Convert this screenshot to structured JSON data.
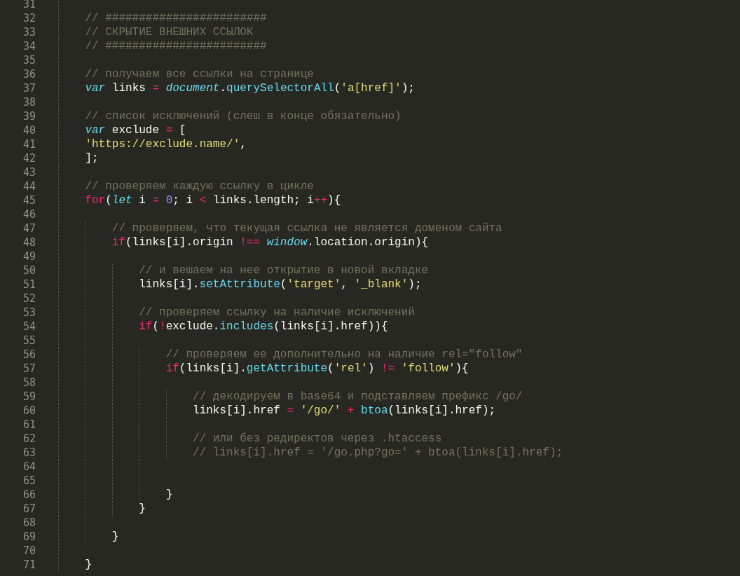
{
  "editor": {
    "lines": [
      {
        "number": "31"
      },
      {
        "number": "32",
        "tokens": [
          {
            "kind": "comment",
            "text": "// ########################"
          }
        ]
      },
      {
        "number": "33",
        "tokens": [
          {
            "kind": "comment",
            "text": "// СКРЫТИЕ ВНЕШНИХ ССЫЛОК"
          }
        ]
      },
      {
        "number": "34",
        "tokens": [
          {
            "kind": "comment",
            "text": "// ########################"
          }
        ]
      },
      {
        "number": "35"
      },
      {
        "number": "36",
        "tokens": [
          {
            "kind": "comment",
            "text": "// получаем все ссылки на странице"
          }
        ]
      },
      {
        "number": "37",
        "tokens": [
          {
            "kind": "storage",
            "text": "var"
          },
          {
            "kind": "plain",
            "text": " links "
          },
          {
            "kind": "operator",
            "text": "= "
          },
          {
            "kind": "storage",
            "text": "document"
          },
          {
            "kind": "plain",
            "text": "."
          },
          {
            "kind": "function",
            "text": "querySelectorAll"
          },
          {
            "kind": "plain",
            "text": "("
          },
          {
            "kind": "string",
            "text": "'a[href]'"
          },
          {
            "kind": "plain",
            "text": ");"
          }
        ]
      },
      {
        "number": "38"
      },
      {
        "number": "39",
        "tokens": [
          {
            "kind": "comment",
            "text": "// список исключений (слеш в конце обязательно)"
          }
        ]
      },
      {
        "number": "40",
        "tokens": [
          {
            "kind": "storage",
            "text": "var"
          },
          {
            "kind": "plain",
            "text": " exclude "
          },
          {
            "kind": "operator",
            "text": "="
          },
          {
            "kind": "plain",
            "text": " ["
          }
        ]
      },
      {
        "number": "41",
        "tokens": [
          {
            "kind": "string",
            "text": "'https://exclude.name/'"
          },
          {
            "kind": "plain",
            "text": ","
          }
        ]
      },
      {
        "number": "42",
        "tokens": [
          {
            "kind": "plain",
            "text": "];"
          }
        ]
      },
      {
        "number": "43"
      },
      {
        "number": "44",
        "tokens": [
          {
            "kind": "comment",
            "text": "// проверяем каждую ссылку в цикле"
          }
        ]
      },
      {
        "number": "45",
        "tokens": [
          {
            "kind": "keyword",
            "text": "for"
          },
          {
            "kind": "plain",
            "text": "("
          },
          {
            "kind": "storage",
            "text": "let"
          },
          {
            "kind": "plain",
            "text": " i "
          },
          {
            "kind": "operator",
            "text": "= "
          },
          {
            "kind": "number",
            "text": "0"
          },
          {
            "kind": "plain",
            "text": "; i "
          },
          {
            "kind": "operator",
            "text": "<"
          },
          {
            "kind": "plain",
            "text": " links.length; i"
          },
          {
            "kind": "operator",
            "text": "++"
          },
          {
            "kind": "plain",
            "text": "){"
          }
        ],
        "children": [
          {
            "number": "46"
          },
          {
            "number": "47",
            "tokens": [
              {
                "kind": "comment",
                "text": "// проверяем, что текущая ссылка не является доменом сайта"
              }
            ]
          },
          {
            "number": "48",
            "tokens": [
              {
                "kind": "keyword",
                "text": "if"
              },
              {
                "kind": "plain",
                "text": "(links[i].origin "
              },
              {
                "kind": "operator",
                "text": "!== "
              },
              {
                "kind": "storage",
                "text": "window"
              },
              {
                "kind": "plain",
                "text": ".location.origin){"
              }
            ],
            "children": [
              {
                "number": "49"
              },
              {
                "number": "50",
                "tokens": [
                  {
                    "kind": "comment",
                    "text": "// и вешаем на нее открытие в новой вкладке"
                  }
                ]
              },
              {
                "number": "51",
                "tokens": [
                  {
                    "kind": "plain",
                    "text": "links[i]."
                  },
                  {
                    "kind": "function",
                    "text": "setAttribute"
                  },
                  {
                    "kind": "plain",
                    "text": "("
                  },
                  {
                    "kind": "string",
                    "text": "'target'"
                  },
                  {
                    "kind": "plain",
                    "text": ", "
                  },
                  {
                    "kind": "string",
                    "text": "'_blank'"
                  },
                  {
                    "kind": "plain",
                    "text": ");"
                  }
                ]
              },
              {
                "number": "52"
              },
              {
                "number": "53",
                "tokens": [
                  {
                    "kind": "comment",
                    "text": "// проверяем ссылку на наличие исключений"
                  }
                ]
              },
              {
                "number": "54",
                "tokens": [
                  {
                    "kind": "keyword",
                    "text": "if"
                  },
                  {
                    "kind": "plain",
                    "text": "("
                  },
                  {
                    "kind": "operator",
                    "text": "!"
                  },
                  {
                    "kind": "plain",
                    "text": "exclude."
                  },
                  {
                    "kind": "function",
                    "text": "includes"
                  },
                  {
                    "kind": "plain",
                    "text": "(links[i].href)){"
                  }
                ],
                "children": [
                  {
                    "number": "55"
                  },
                  {
                    "number": "56",
                    "tokens": [
                      {
                        "kind": "comment",
                        "text": "// проверяем ее дополнительно на наличие rel=\"follow\""
                      }
                    ]
                  },
                  {
                    "number": "57",
                    "tokens": [
                      {
                        "kind": "keyword",
                        "text": "if"
                      },
                      {
                        "kind": "plain",
                        "text": "(links[i]."
                      },
                      {
                        "kind": "function",
                        "text": "getAttribute"
                      },
                      {
                        "kind": "plain",
                        "text": "("
                      },
                      {
                        "kind": "string",
                        "text": "'rel'"
                      },
                      {
                        "kind": "plain",
                        "text": ") "
                      },
                      {
                        "kind": "operator",
                        "text": "!= "
                      },
                      {
                        "kind": "string",
                        "text": "'follow'"
                      },
                      {
                        "kind": "plain",
                        "text": "){"
                      }
                    ],
                    "children": [
                      {
                        "number": "58"
                      },
                      {
                        "number": "59",
                        "tokens": [
                          {
                            "kind": "comment",
                            "text": "// декодируем в base64 и подставляем префикс /go/"
                          }
                        ]
                      },
                      {
                        "number": "60",
                        "tokens": [
                          {
                            "kind": "plain",
                            "text": "links[i].href "
                          },
                          {
                            "kind": "operator",
                            "text": "= "
                          },
                          {
                            "kind": "string",
                            "text": "'/go/'"
                          },
                          {
                            "kind": "operator",
                            "text": " + "
                          },
                          {
                            "kind": "function",
                            "text": "btoa"
                          },
                          {
                            "kind": "plain",
                            "text": "(links[i].href);"
                          }
                        ]
                      },
                      {
                        "number": "61"
                      },
                      {
                        "number": "62",
                        "tokens": [
                          {
                            "kind": "comment",
                            "text": "// или без редиректов через .htaccess"
                          }
                        ]
                      },
                      {
                        "number": "63",
                        "tokens": [
                          {
                            "kind": "comment",
                            "text": "// links[i].href = '/go.php?go=' + btoa(links[i].href);"
                          }
                        ]
                      },
                      {
                        "number": "64"
                      },
                      {
                        "number": "65"
                      }
                    ]
                  },
                  {
                    "number": "66",
                    "tokens": [
                      {
                        "kind": "plain",
                        "text": "}"
                      }
                    ]
                  }
                ]
              },
              {
                "number": "67",
                "tokens": [
                  {
                    "kind": "plain",
                    "text": "}"
                  }
                ]
              }
            ]
          },
          {
            "number": "68"
          },
          {
            "number": "69",
            "tokens": [
              {
                "kind": "plain",
                "text": "}"
              }
            ]
          }
        ]
      },
      {
        "number": "70"
      },
      {
        "number": "71",
        "tokens": [
          {
            "kind": "plain",
            "text": "}"
          }
        ]
      }
    ]
  }
}
